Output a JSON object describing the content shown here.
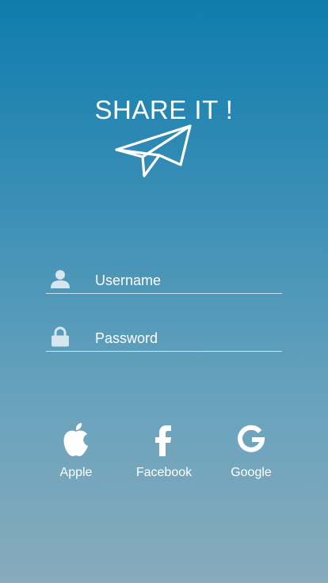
{
  "app": {
    "title": "SHARE IT !"
  },
  "login": {
    "username_placeholder": "Username",
    "password_placeholder": "Password"
  },
  "social": [
    {
      "label": "Apple",
      "icon": "apple-icon"
    },
    {
      "label": "Facebook",
      "icon": "facebook-icon"
    },
    {
      "label": "Google",
      "icon": "google-icon"
    }
  ],
  "colors": {
    "gradient_top": "#0e7cad",
    "gradient_bottom": "#86abbc",
    "foreground": "#ffffff",
    "field_icon": "#d6e6ef"
  }
}
